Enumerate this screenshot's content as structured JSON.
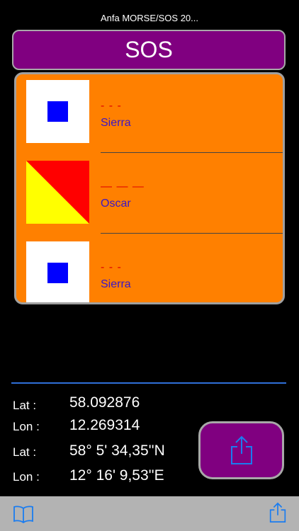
{
  "app": {
    "title": "Anfa MORSE/SOS 20..."
  },
  "header": {
    "word": "SOS"
  },
  "flags": [
    {
      "morse": "- - -",
      "name": "Sierra",
      "flag_icon": "sierra-flag-icon"
    },
    {
      "morse": "— — —",
      "name": "Oscar",
      "flag_icon": "oscar-flag-icon"
    },
    {
      "morse": "- - -",
      "name": "Sierra",
      "flag_icon": "sierra-flag-icon"
    }
  ],
  "coords": {
    "lat_label_1": "Lat :",
    "lat_decimal": "58.092876",
    "lon_label_1": "Lon :",
    "lon_decimal": "12.269314",
    "lat_label_2": "Lat :",
    "lat_dms": "58° 5' 34,35''N",
    "lon_label_2": "Lon :",
    "lon_dms": "12° 16' 9,53''E"
  },
  "colors": {
    "accent_purple": "#800080",
    "panel_orange": "#ff8000",
    "morse_red": "#e00000",
    "name_blue": "#3a16c8",
    "divider_blue": "#2f6fd8",
    "toolbar_gray": "#b3b3b3",
    "icon_blue": "#1a7cf0"
  },
  "toolbar": {
    "left_icon": "book-icon",
    "right_icon": "share-icon"
  }
}
